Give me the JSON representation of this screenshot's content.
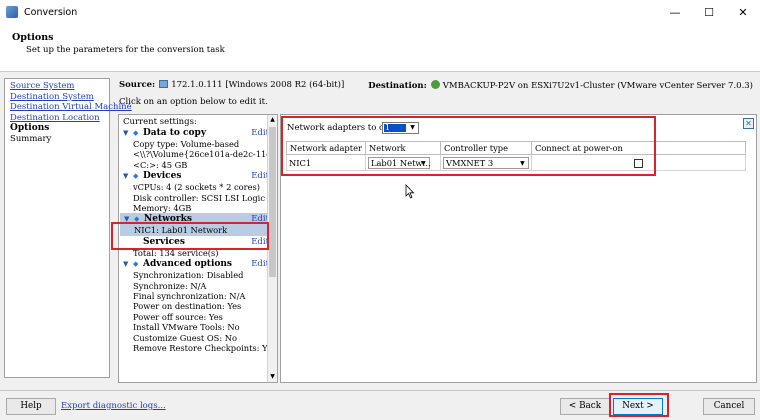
{
  "window": {
    "title": "Conversion",
    "minimize": "—",
    "maximize": "☐",
    "close": "✕"
  },
  "header": {
    "title": "Options",
    "subtitle": "Set up the parameters for the conversion task"
  },
  "nav": {
    "items": [
      {
        "label": "Source System",
        "state": "link"
      },
      {
        "label": "Destination System",
        "state": "link"
      },
      {
        "label": "Destination Virtual Machine",
        "state": "link"
      },
      {
        "label": "Destination Location",
        "state": "link"
      },
      {
        "label": "Options",
        "state": "active"
      },
      {
        "label": "Summary",
        "state": "plain"
      }
    ]
  },
  "source_bar": {
    "source_label": "Source:",
    "source_value": "172.1.0.111 [Windows 2008 R2 (64-bit)]",
    "destination_label": "Destination:",
    "destination_value": "VMBACKUP-P2V on ESXi7U2v1-Cluster (VMware vCenter Server 7.0.3)"
  },
  "hint": "Click on an option below to edit it.",
  "settings": {
    "heading": "Current settings:",
    "edit_label": "Edit",
    "sections": [
      {
        "title": "Data to copy",
        "lines": [
          "Copy type: Volume-based",
          "<\\\\?\\Volume{26ce101a-de2c-11e6-a2…",
          "<C:>: 45 GB"
        ]
      },
      {
        "title": "Devices",
        "lines": [
          "vCPUs: 4 (2 sockets * 2 cores)",
          "Disk controller: SCSI LSI Logic SAS",
          "Memory: 4GB"
        ]
      },
      {
        "title": "Networks",
        "lines": [
          "NIC1: Lab01 Network"
        ]
      },
      {
        "title": "Services",
        "lines": [
          "Total: 134 service(s)"
        ]
      },
      {
        "title": "Advanced options",
        "lines": [
          "Synchronization: Disabled",
          "Synchronize: N/A",
          "Final synchronization: N/A",
          "Power on destination: Yes",
          "Power off source: Yes",
          "Install VMware Tools: No",
          "Customize Guest OS: No",
          "Remove Restore Checkpoints: Yes"
        ]
      }
    ]
  },
  "detail": {
    "adapters_label": "Network adapters to connect:",
    "adapters_count": "1",
    "columns": [
      "Network adapter",
      "Network",
      "Controller type",
      "Connect at power-on"
    ],
    "rows": [
      {
        "adapter": "NIC1",
        "network": "Lab01 Netw…",
        "controller": "VMXNET 3",
        "connect": false
      }
    ]
  },
  "footer": {
    "help": "Help",
    "export": "Export diagnostic logs...",
    "back": "< Back",
    "next": "Next >",
    "cancel": "Cancel"
  },
  "colors": {
    "highlight_box": "#d8232a",
    "selected_section": "#b9cce4",
    "link": "#1f3fbf"
  }
}
